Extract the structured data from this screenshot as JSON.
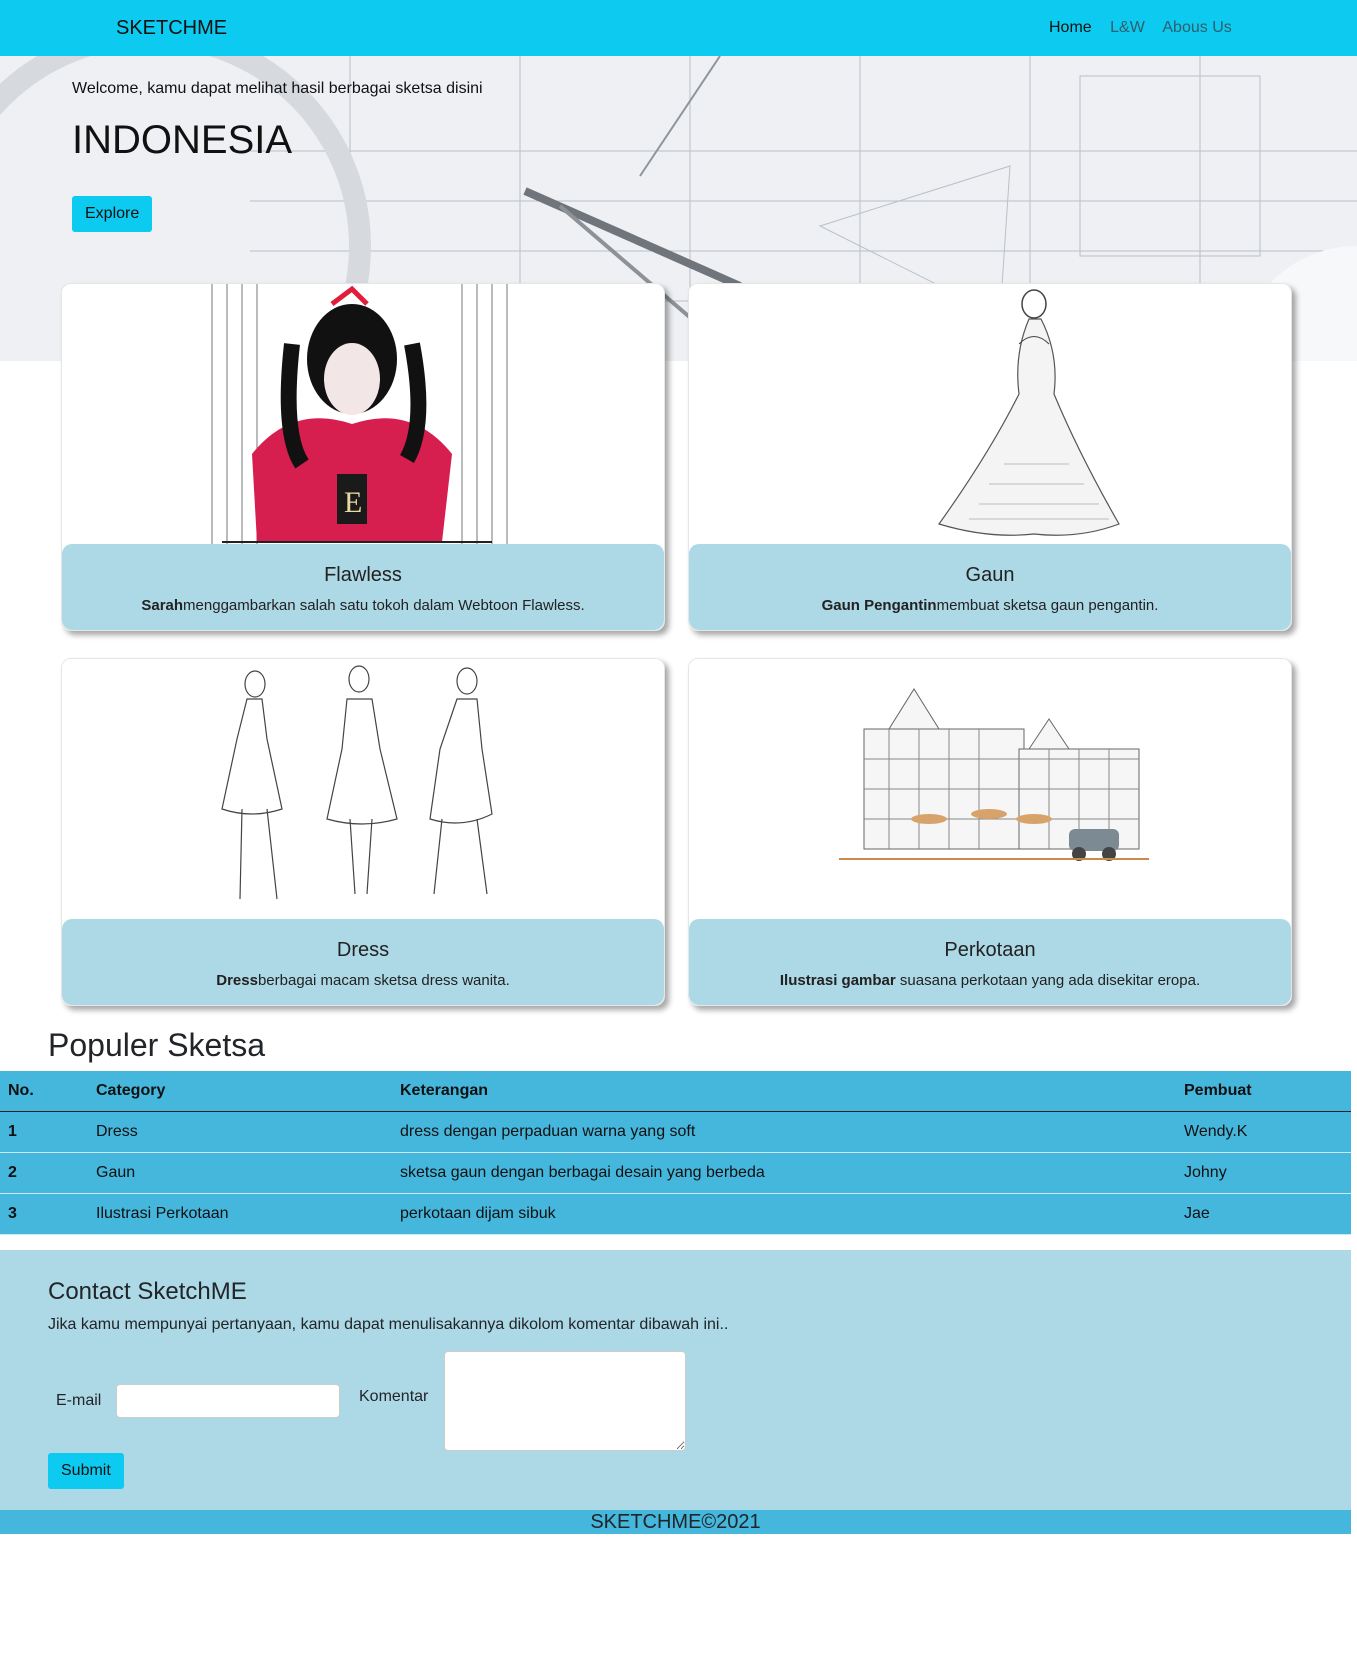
{
  "navbar": {
    "brand": "SKETCHME",
    "links": [
      "Home",
      "L&W",
      "Abous Us"
    ]
  },
  "hero": {
    "welcome": "Welcome, kamu dapat melihat hasil berbagai sketsa disini",
    "title": "INDONESIA",
    "button": "Explore"
  },
  "cards": [
    {
      "title": "Flawless",
      "bold": "Sarah",
      "text": "menggambarkan salah satu tokoh dalam Webtoon Flawless."
    },
    {
      "title": "Gaun",
      "bold": "Gaun Pengantin",
      "text": "membuat sketsa gaun pengantin."
    },
    {
      "title": "Dress",
      "bold": "Dress",
      "text": "berbagai macam sketsa dress wanita."
    },
    {
      "title": "Perkotaan",
      "bold": "Ilustrasi gambar",
      "text": " suasana perkotaan yang ada disekitar eropa."
    }
  ],
  "table": {
    "title": "Populer Sketsa",
    "headers": [
      "No.",
      "Category",
      "Keterangan",
      "Pembuat"
    ],
    "rows": [
      [
        "1",
        "Dress",
        "dress dengan perpaduan warna yang soft",
        "Wendy.K"
      ],
      [
        "2",
        "Gaun",
        "sketsa gaun dengan berbagai desain yang berbeda",
        "Johny"
      ],
      [
        "3",
        "Ilustrasi Perkotaan",
        "perkotaan dijam sibuk",
        "Jae"
      ]
    ]
  },
  "contact": {
    "title": "Contact SketchME",
    "description": "Jika kamu mempunyai pertanyaan, kamu dapat menulisakannya dikolom komentar dibawah ini..",
    "email_label": "E-mail",
    "comment_label": "Komentar",
    "submit": "Submit"
  },
  "footer": "SKETCHME©2021",
  "colors": {
    "accent": "#0dcaf0",
    "card_body": "#add8e6",
    "table": "#45b6dc"
  }
}
